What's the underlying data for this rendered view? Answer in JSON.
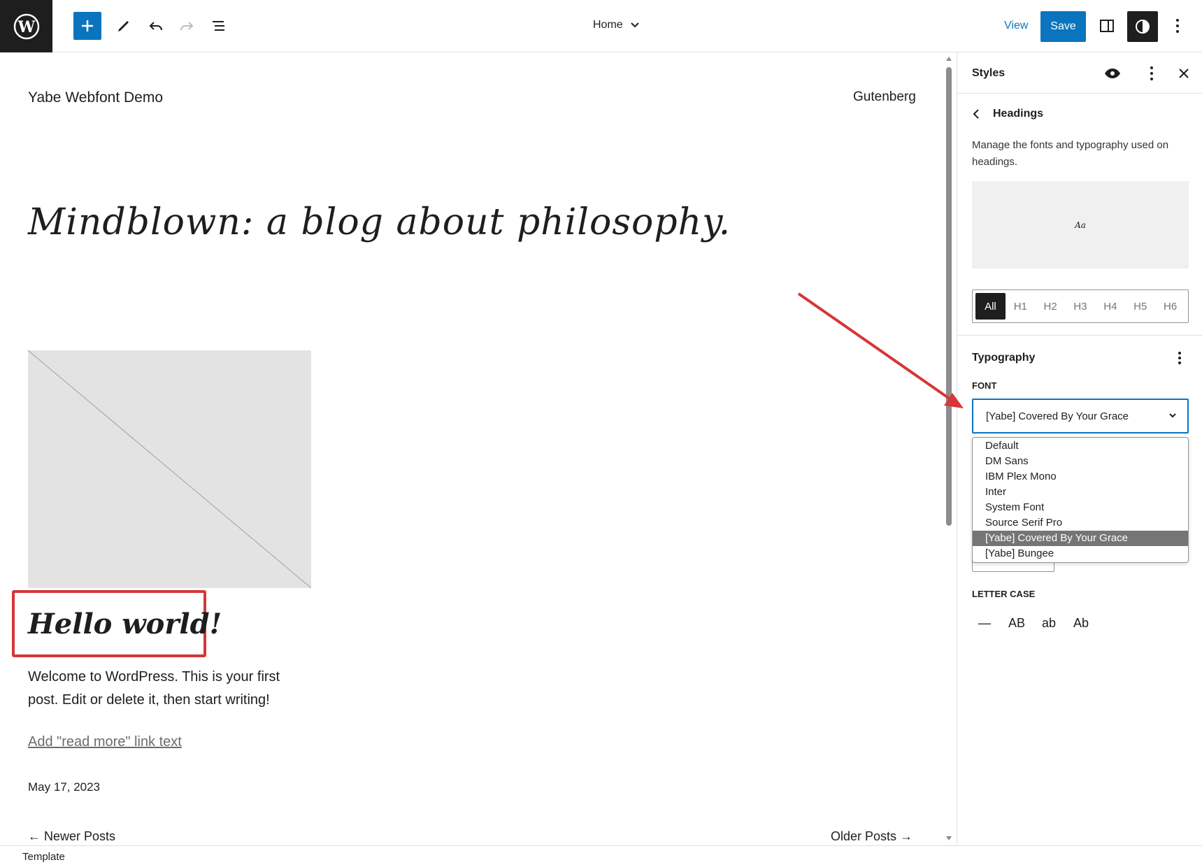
{
  "topbar": {
    "page_name": "Home",
    "view_label": "View",
    "save_label": "Save"
  },
  "canvas": {
    "site_title": "Yabe Webfont Demo",
    "nav_item": "Gutenberg",
    "blog_title": "Mindblown: a blog about philosophy.",
    "post_title": "Hello world!",
    "excerpt": "Welcome to WordPress. This is your first post. Edit or delete it, then start writing!",
    "read_more": "Add \"read more\" link text",
    "date": "May 17, 2023",
    "newer_posts": "←  Newer Posts",
    "older_posts": "Older Posts  →"
  },
  "footer": {
    "label": "Template"
  },
  "sidebar": {
    "title": "Styles",
    "section_title": "Headings",
    "description": "Manage the fonts and typography used on headings.",
    "preview_text": "Aa",
    "levels": [
      "All",
      "H1",
      "H2",
      "H3",
      "H4",
      "H5",
      "H6"
    ],
    "active_level": "All",
    "typography_title": "Typography",
    "font_label": "FONT",
    "font_selected": "[Yabe] Covered By Your Grace",
    "font_options": [
      "Default",
      "DM Sans",
      "IBM Plex Mono",
      "Inter",
      "System Font",
      "Source Serif Pro",
      "[Yabe] Covered By Your Grace",
      "[Yabe] Bungee"
    ],
    "letter_case_label": "LETTER CASE",
    "letter_case_options": [
      "—",
      "AB",
      "ab",
      "Ab"
    ]
  },
  "colors": {
    "accent": "#0a75be",
    "dark": "#1e1e1e",
    "annotation_red": "#d63638",
    "selected_option_bg": "#757575"
  },
  "icons": [
    "wordpress-logo-icon",
    "plus-icon",
    "pencil-icon",
    "undo-icon",
    "redo-icon",
    "list-view-icon",
    "chevron-down-icon",
    "sidebar-toggle-icon",
    "contrast-icon",
    "more-vertical-icon",
    "eye-icon",
    "close-icon",
    "chevron-left-icon",
    "annotation-arrow-icon"
  ]
}
